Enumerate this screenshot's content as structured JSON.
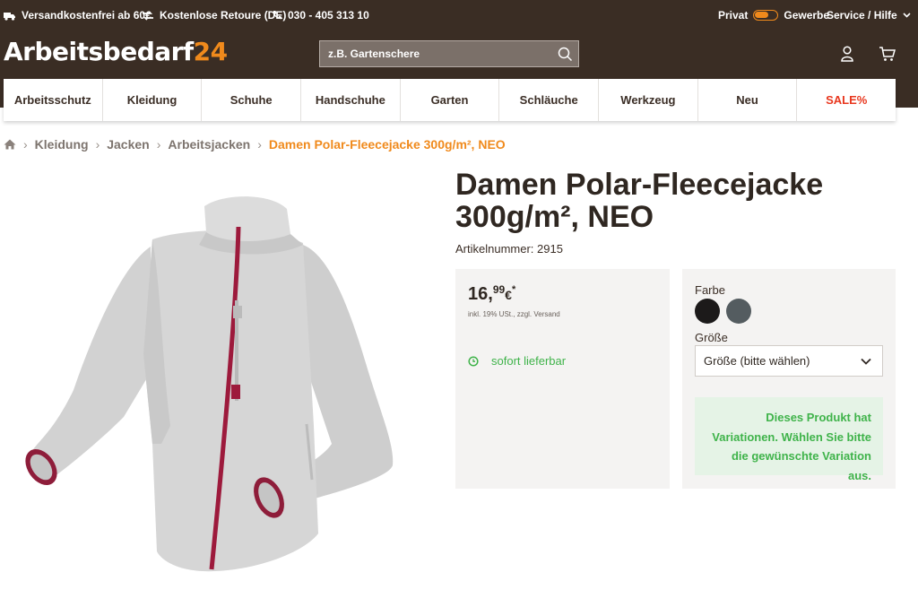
{
  "topbar": {
    "shipping": "Versandkostenfrei ab 60€",
    "returns": "Kostenlose Retoure (DE)",
    "phone": "030 - 405 313 10",
    "toggle_left": "Privat",
    "toggle_right": "Gewerbe",
    "service": "Service / Hilfe"
  },
  "logo": {
    "text": "Arbeitsbedarf",
    "number": "24"
  },
  "search": {
    "placeholder": "z.B. Gartenschere"
  },
  "nav": [
    "Arbeitsschutz",
    "Kleidung",
    "Schuhe",
    "Handschuhe",
    "Garten",
    "Schläuche",
    "Werkzeug",
    "Neu",
    "SALE%"
  ],
  "breadcrumb": [
    "Kleidung",
    "Jacken",
    "Arbeitsjacken",
    "Damen Polar-Fleecejacke 300g/m², NEO"
  ],
  "product": {
    "title": "Damen Polar-Fleecejacke 300g/m², NEO",
    "article_number": "Artikelnummer: 2915",
    "price_main": "16,",
    "price_cents": "99",
    "price_currency": "€",
    "price_star": "*",
    "tax_note": "inkl. 19% USt., zzgl. Versand",
    "availability": "sofort lieferbar"
  },
  "variations": {
    "color_label": "Farbe",
    "colors": [
      "#1c1a1a",
      "#545c60"
    ],
    "size_label": "Größe",
    "size_selected": "Größe (bitte wählen)",
    "notice": "Dieses Produkt hat Variationen. Wählen Sie bitte die gewünschte Variation aus."
  },
  "colors": {
    "header_bg": "#3a2d24",
    "accent": "#f08a1c",
    "sale": "#e8371e",
    "success": "#3fb34a"
  }
}
